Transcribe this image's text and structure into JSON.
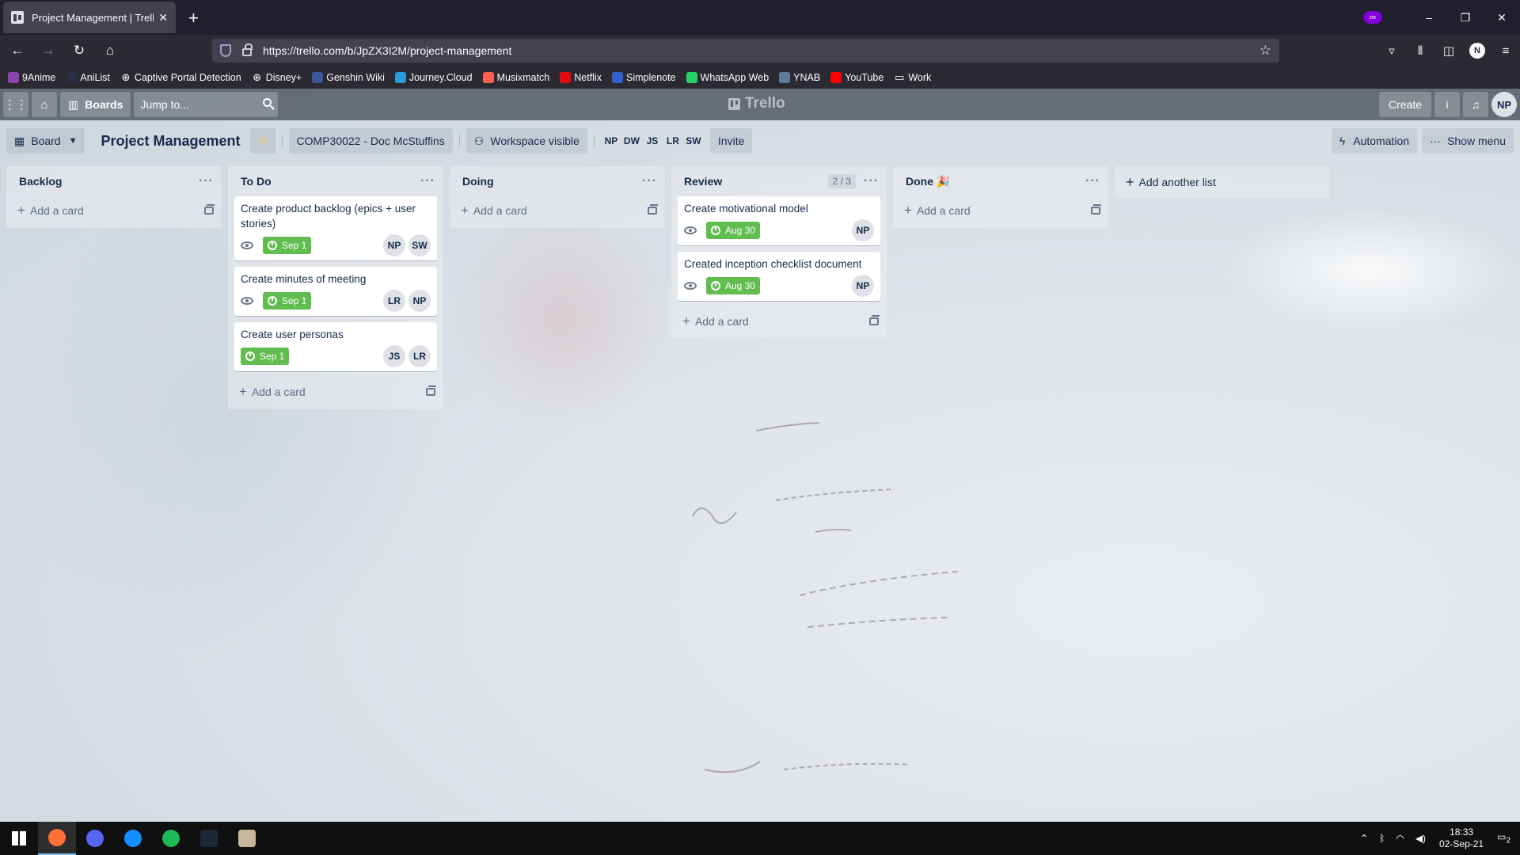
{
  "browser": {
    "tab_title": "Project Management | Trello",
    "tab_close": "✕",
    "new_tab": "+",
    "url": "https://trello.com/b/JpZX3I2M/project-management",
    "private_icon": "∞",
    "window_controls": [
      "–",
      "❐",
      "✕"
    ],
    "bookmarks": [
      {
        "label": "9Anime",
        "icon": "anime-icon",
        "color": "#8e44ad"
      },
      {
        "label": "AniList",
        "icon": "anilist-icon",
        "color": "#2b2d42"
      },
      {
        "label": "Captive Portal Detection",
        "icon": "globe-icon",
        "color": "#2b2a33"
      },
      {
        "label": "Disney+",
        "icon": "globe-icon",
        "color": "#2b2a33"
      },
      {
        "label": "Genshin Wiki",
        "icon": "genshin-icon",
        "color": "#3b5998"
      },
      {
        "label": "Journey.Cloud",
        "icon": "journey-icon",
        "color": "#2d9cdb"
      },
      {
        "label": "Musixmatch",
        "icon": "musixmatch-icon",
        "color": "#ff6050"
      },
      {
        "label": "Netflix",
        "icon": "netflix-icon",
        "color": "#e50914"
      },
      {
        "label": "Simplenote",
        "icon": "simplenote-icon",
        "color": "#3361cc"
      },
      {
        "label": "WhatsApp Web",
        "icon": "whatsapp-icon",
        "color": "#25d366"
      },
      {
        "label": "YNAB",
        "icon": "ynab-icon",
        "color": "#5d7a99"
      },
      {
        "label": "YouTube",
        "icon": "youtube-icon",
        "color": "#ff0000"
      },
      {
        "label": "Work",
        "icon": "folder-icon",
        "color": "#2b2a33"
      }
    ],
    "account_initial": "N"
  },
  "trello_header": {
    "boards_label": "Boards",
    "search_placeholder": "Jump to...",
    "logo_text": "Trello",
    "create_label": "Create",
    "info_icon": "i",
    "bell_icon": "🔔",
    "user_initials": "NP"
  },
  "board_header": {
    "view_label": "Board",
    "title": "Project Management",
    "workspace": "COMP30022 - Doc McStuffins",
    "visibility": "Workspace visible",
    "members": [
      "NP",
      "DW",
      "JS",
      "LR",
      "SW"
    ],
    "invite_label": "Invite",
    "automation_label": "Automation",
    "show_menu_label": "Show menu"
  },
  "lists": [
    {
      "name": "Backlog",
      "limit": "",
      "cards": [],
      "add_card": "Add a card"
    },
    {
      "name": "To Do",
      "limit": "",
      "add_card": "Add a card",
      "cards": [
        {
          "title": "Create product backlog (epics + user stories)",
          "watch": true,
          "due": "Sep 1",
          "members": [
            "NP",
            "SW"
          ]
        },
        {
          "title": "Create minutes of meeting",
          "watch": true,
          "due": "Sep 1",
          "members": [
            "LR",
            "NP"
          ]
        },
        {
          "title": "Create user personas",
          "watch": false,
          "due": "Sep 1",
          "members": [
            "JS",
            "LR"
          ]
        }
      ]
    },
    {
      "name": "Doing",
      "limit": "",
      "cards": [],
      "add_card": "Add a card"
    },
    {
      "name": "Review",
      "limit": "2 / 3",
      "add_card": "Add a card",
      "cards": [
        {
          "title": "Create motivational model",
          "watch": true,
          "due": "Aug 30",
          "members": [
            "NP"
          ]
        },
        {
          "title": "Created inception checklist document",
          "watch": true,
          "due": "Aug 30",
          "members": [
            "NP"
          ]
        }
      ]
    },
    {
      "name": "Done 🎉",
      "limit": "",
      "cards": [],
      "add_card": "Add a card"
    }
  ],
  "add_list_label": "Add another list",
  "taskbar": {
    "apps": [
      {
        "name": "windows-start-icon",
        "color": "#ffffff"
      },
      {
        "name": "firefox-icon",
        "color": "#ff7139",
        "active": true
      },
      {
        "name": "discord-icon",
        "color": "#5865f2"
      },
      {
        "name": "battlenet-icon",
        "color": "#148eff"
      },
      {
        "name": "spotify-icon",
        "color": "#1db954"
      },
      {
        "name": "steam-icon",
        "color": "#1b2838"
      },
      {
        "name": "genshin-app-icon",
        "color": "#c9b79c"
      }
    ],
    "time": "18:33",
    "date": "02-Sep-21",
    "notifications": "2"
  }
}
